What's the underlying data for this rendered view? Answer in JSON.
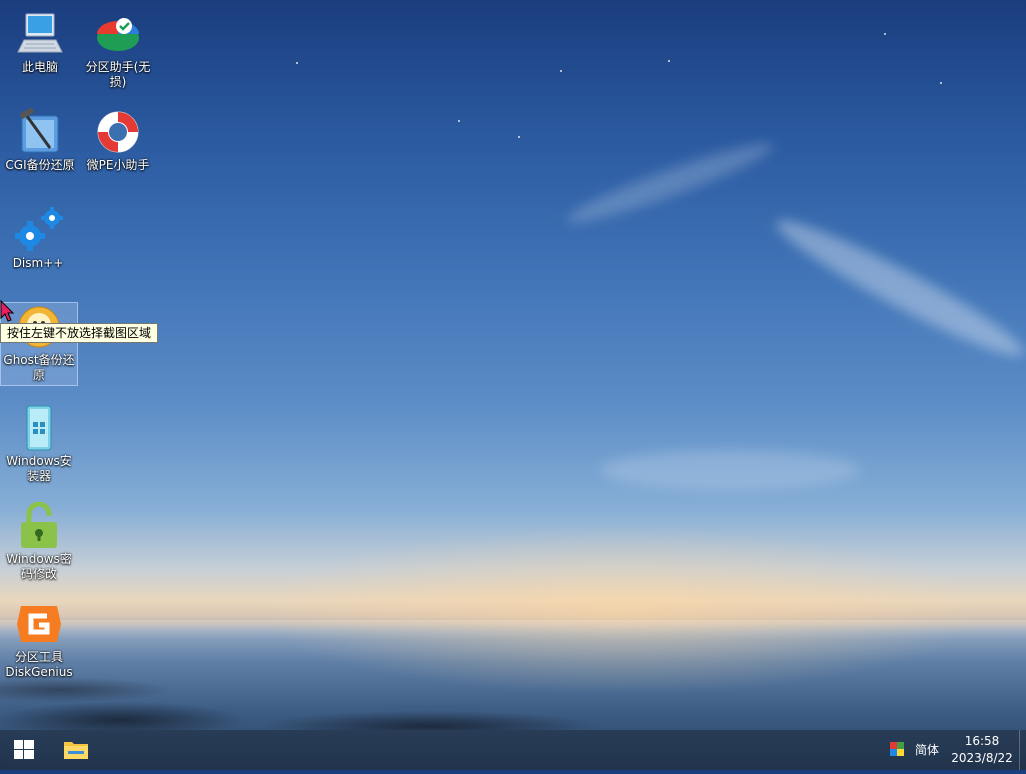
{
  "desktop": {
    "icons": [
      {
        "label": "此电脑",
        "icon": "computer-icon"
      },
      {
        "label": "分区助手(无损)",
        "icon": "partition-assistant-icon"
      },
      {
        "label": "CGI备份还原",
        "icon": "cgi-backup-icon"
      },
      {
        "label": "微PE小助手",
        "icon": "lifebuoy-icon"
      },
      {
        "label": "Dism++",
        "icon": "gears-icon"
      },
      {
        "label": "Ghost备份还原",
        "icon": "ghost-icon"
      },
      {
        "label": "Windows安装器",
        "icon": "windows-installer-icon"
      },
      {
        "label": "Windows密码修改",
        "icon": "lock-icon"
      },
      {
        "label": "分区工具DiskGenius",
        "icon": "diskgenius-icon"
      }
    ]
  },
  "tooltip": {
    "text": "按住左键不放选择截图区域"
  },
  "taskbar": {
    "ime_label": "简体",
    "clock_time": "16:58",
    "clock_date": "2023/8/22"
  },
  "colors": {
    "accent": "#0078d7",
    "taskbar": "#1e2a3c"
  }
}
